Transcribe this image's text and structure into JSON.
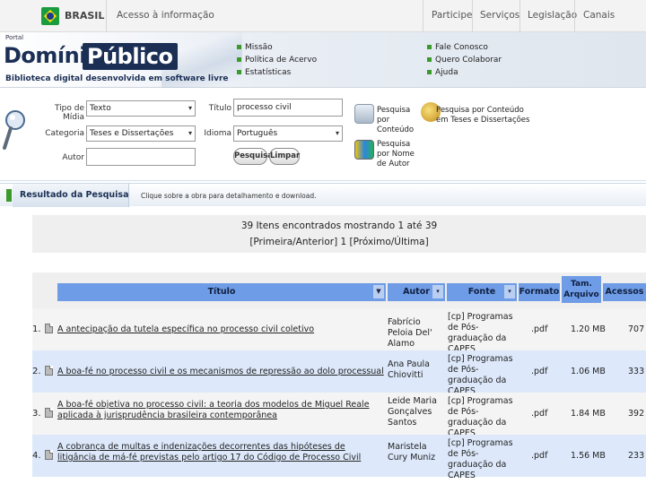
{
  "gov_bar": {
    "brand": "BRASIL",
    "access": "Acesso à informação",
    "links": [
      "Participe",
      "Serviços",
      "Legislação",
      "Canais"
    ]
  },
  "portal": {
    "small_label": "Portal",
    "logo_part1": "Domínio",
    "logo_part2": "Público",
    "tagline": "Biblioteca digital desenvolvida em software livre",
    "links_col1": [
      "Missão",
      "Política de Acervo",
      "Estatísticas"
    ],
    "links_col2": [
      "Fale Conosco",
      "Quero Colaborar",
      "Ajuda"
    ]
  },
  "search": {
    "media_type_label": "Tipo de Mídia",
    "media_type_value": "Texto",
    "category_label": "Categoria",
    "category_value": "Teses e Dissertações",
    "author_label": "Autor",
    "author_value": "",
    "title_label": "Título",
    "title_value": "processo civil",
    "language_label": "Idioma",
    "language_value": "Português",
    "search_button": "Pesquisar",
    "clear_button": "Limpar",
    "options": [
      "Pesquisa por Conteúdo",
      "Pesquisa por Conteúdo em Teses e Dissertações",
      "Pesquisa por Nome de Autor"
    ]
  },
  "results": {
    "section_title": "Resultado da Pesquisa",
    "hint": "Clique sobre a obra para detalhamento e download.",
    "count_text": "39 Itens encontrados mostrando 1 até 39",
    "pagination": "[Primeira/Anterior] 1 [Próximo/Última]",
    "columns": [
      "Título",
      "Autor",
      "Fonte",
      "Formato",
      "Tam. Arquivo",
      "Acessos"
    ],
    "rows": [
      {
        "num": "1.",
        "title": "A antecipação da tutela específica no processo civil coletivo",
        "author": "Fabrício Peloia Del' Alamo",
        "source": "[cp] Programas de Pós-graduação da CAPES",
        "format": ".pdf",
        "size": "1.20 MB",
        "hits": "707"
      },
      {
        "num": "2.",
        "title": "A boa-fé no processo civil e os mecanismos de repressão ao dolo processual",
        "author": "Ana Paula Chiovitti",
        "source": "[cp] Programas de Pós-graduação da CAPES",
        "format": ".pdf",
        "size": "1.06 MB",
        "hits": "333"
      },
      {
        "num": "3.",
        "title": "A boa-fé objetiva no processo civil: a teoria dos modelos de Miguel Reale aplicada à jurisprudência brasileira contemporânea",
        "author": "Leide Maria Gonçalves Santos",
        "source": "[cp] Programas de Pós-graduação da CAPES",
        "format": ".pdf",
        "size": "1.84 MB",
        "hits": "392"
      },
      {
        "num": "4.",
        "title": "A cobrança de multas e indenizações decorrentes das hipóteses de litigância de má-fé previstas pelo artigo 17 do Código de Processo Civil",
        "author": "Maristela Cury Muniz",
        "source": "[cp] Programas de Pós-graduação da CAPES",
        "format": ".pdf",
        "size": "1.56 MB",
        "hits": "233"
      }
    ]
  }
}
